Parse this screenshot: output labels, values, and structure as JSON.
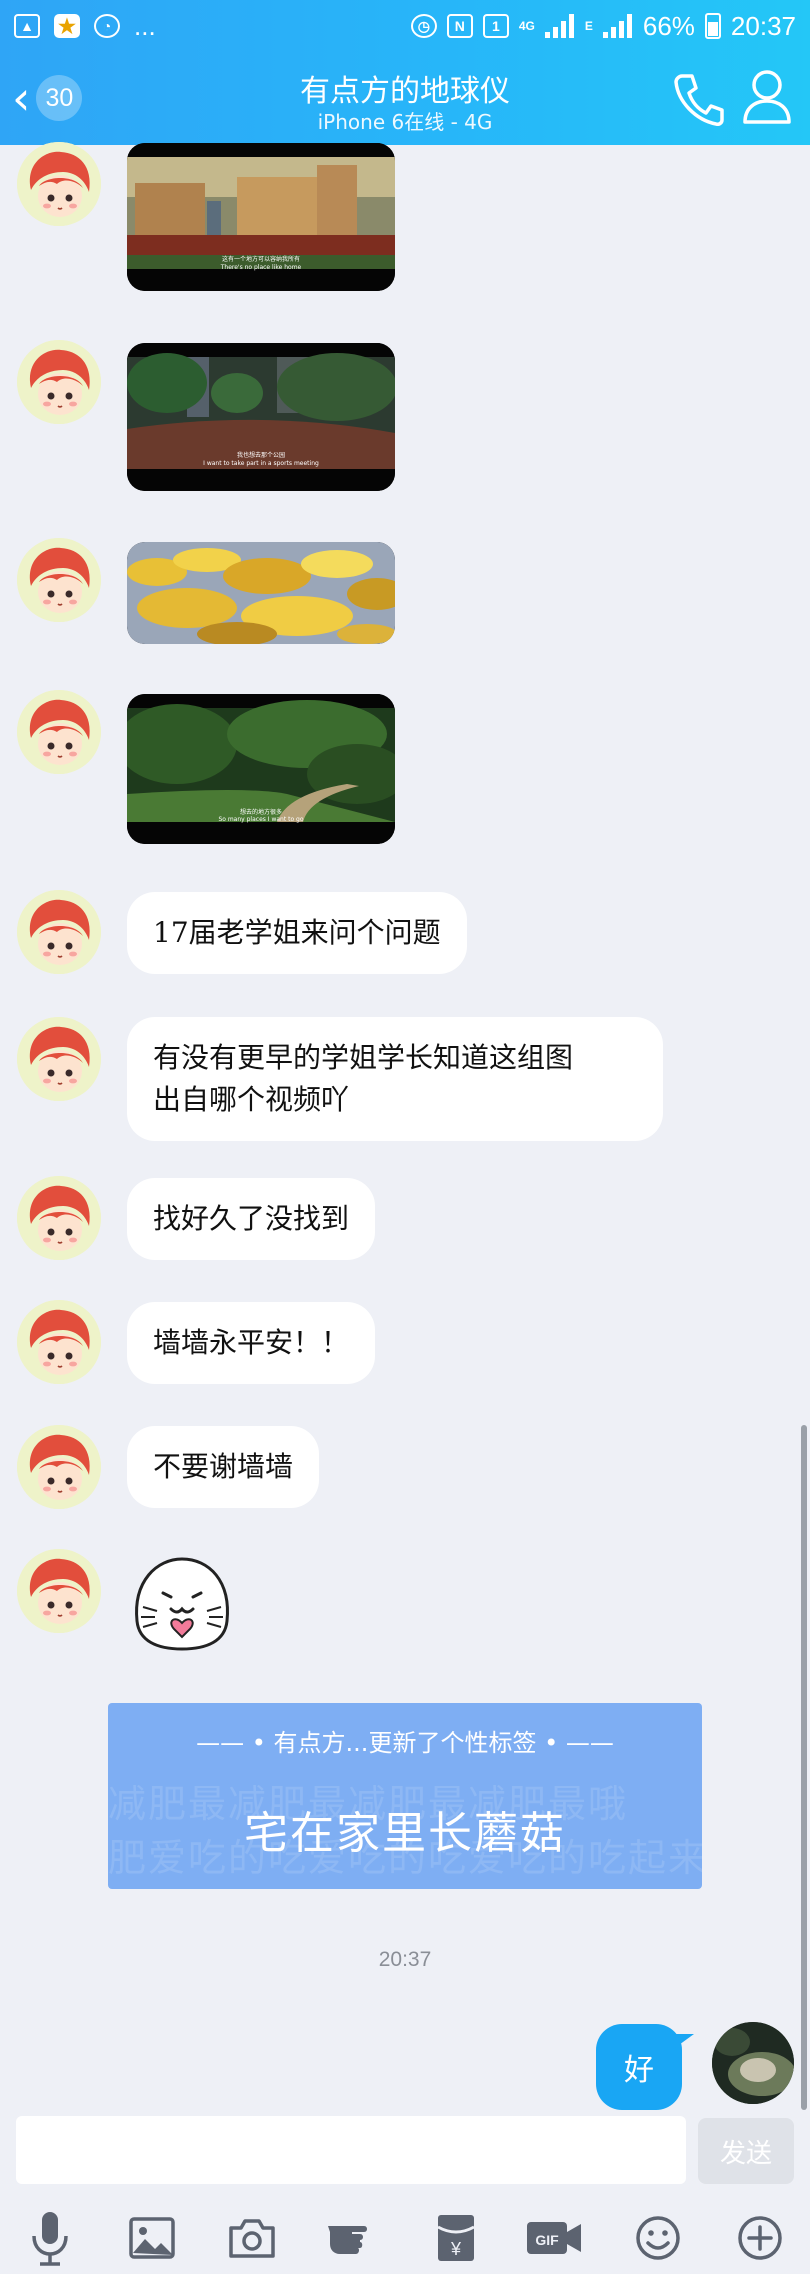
{
  "status_bar": {
    "dots": "...",
    "network_4g": "4G",
    "network_e": "E",
    "battery": "66%",
    "time": "20:37"
  },
  "header": {
    "back_count": "30",
    "title": "有点方的地球仪",
    "subtitle": "iPhone 6在线 - 4G"
  },
  "messages": {
    "text_1": "17届老学姐来问个问题",
    "text_2_line1": "有没有更早的学姐学长知道这组图",
    "text_2_line2": "出自哪个视频吖",
    "text_3": "找好久了没找到",
    "text_4": "墙墙永平安！！",
    "text_5": "不要谢墙墙"
  },
  "photos": {
    "caption_1a": "这有一个地方可以容纳我所有",
    "caption_1b": "There's no place like home",
    "caption_2a": "我也想去那个公园",
    "caption_2b": "I want to take part in a sports meeting",
    "caption_4a": "想去的地方很多",
    "caption_4b": "So many places I want to go"
  },
  "signature_card": {
    "header": "—— • 有点方...更新了个性标签 • ——",
    "text": "宅在家里长蘑菇",
    "bg_line1": "减肥最减肥最减肥最减肥最哦",
    "bg_line2": "肥爱吃的吃爱吃的吃爱吃的吃起来"
  },
  "timestamp": "20:37",
  "my_message": "好",
  "input": {
    "placeholder": "",
    "send_label": "发送"
  },
  "toolbar": {
    "gif_label": "GIF",
    "redpacket_label": "¥"
  },
  "colors": {
    "header_start": "#2fa5f6",
    "header_end": "#24c7f7",
    "my_bubble": "#19a6f4",
    "card_bg": "#7eaef3",
    "page_bg": "#eef0f6"
  }
}
